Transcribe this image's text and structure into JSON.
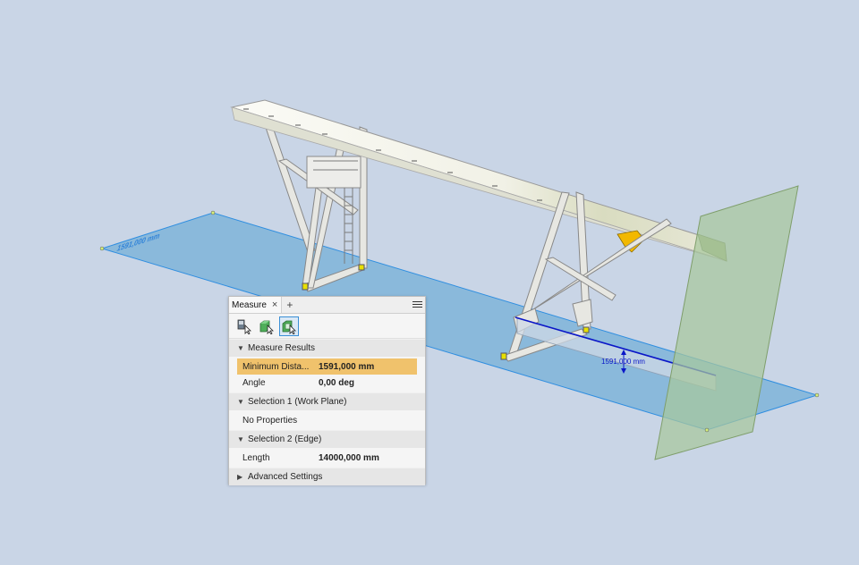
{
  "viewport": {
    "dimension_label": "1591,000 mm",
    "ground_plane_text": "1591,000 mm",
    "colors": {
      "background": "#c9d5e6",
      "work_plane": "#7fb4d8",
      "edge_line": "#0a16c8",
      "vertical_plane": "#a8c79c",
      "gantry": "#f4f4ee"
    }
  },
  "measure_panel": {
    "tab_title": "Measure",
    "close_icon": "×",
    "add_icon": "+",
    "toolbar": [
      "measure-distance-icon",
      "measure-angle-icon",
      "measure-select-icon"
    ],
    "sections": {
      "results": {
        "title": "Measure Results",
        "rows": [
          {
            "label": "Minimum Dista...",
            "value": "1591,000 mm"
          },
          {
            "label": "Angle",
            "value": "0,00 deg"
          }
        ]
      },
      "selection1": {
        "title": "Selection 1 (Work Plane)",
        "text": "No Properties"
      },
      "selection2": {
        "title": "Selection 2 (Edge)",
        "rows": [
          {
            "label": "Length",
            "value": "14000,000 mm"
          }
        ]
      },
      "advanced": {
        "title": "Advanced Settings"
      }
    }
  }
}
